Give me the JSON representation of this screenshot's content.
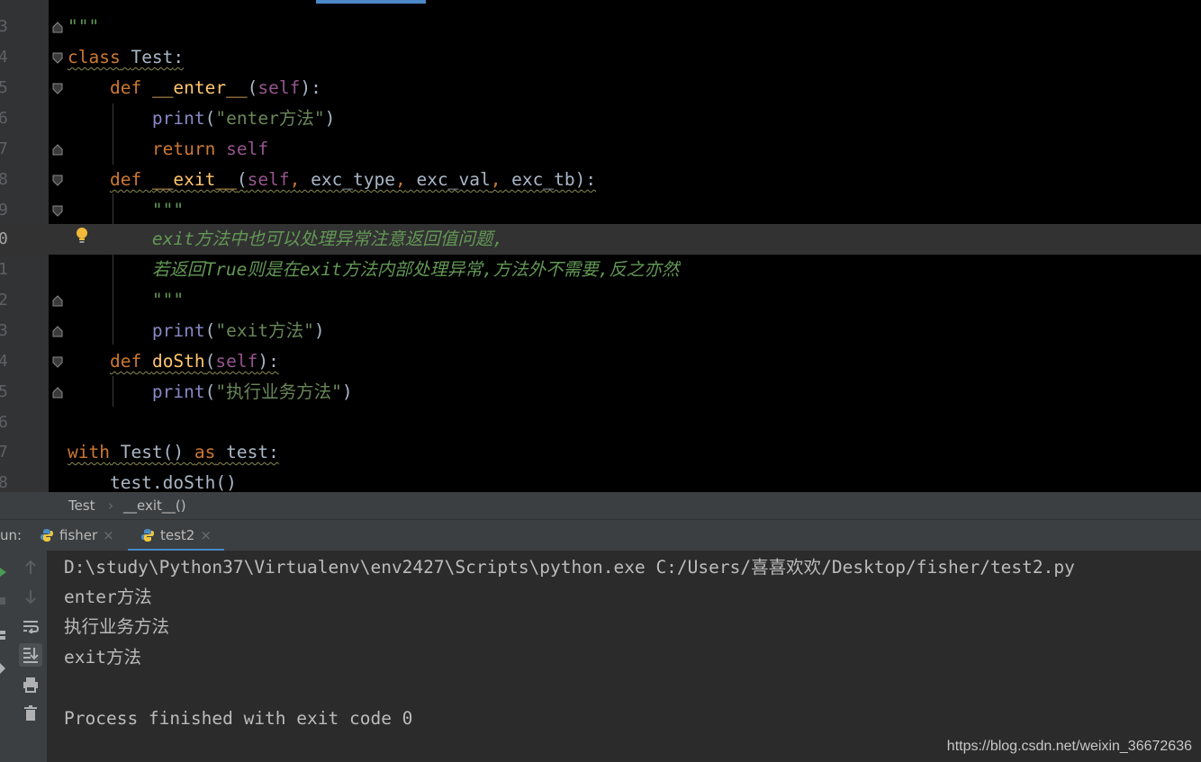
{
  "editor": {
    "lines": [
      {
        "num": "3",
        "code": "\"\"\""
      },
      {
        "num": "4",
        "code": "class Test:"
      },
      {
        "num": "5",
        "code": "    def __enter__(self):"
      },
      {
        "num": "6",
        "code": "        print(\"enter方法\")"
      },
      {
        "num": "7",
        "code": "        return self"
      },
      {
        "num": "8",
        "code": "    def __exit__(self, exc_type, exc_val, exc_tb):"
      },
      {
        "num": "9",
        "code": "        \"\"\""
      },
      {
        "num": "0",
        "code": "        exit方法中也可以处理异常注意返回值问题,"
      },
      {
        "num": "1",
        "code": "        若返回True则是在exit方法内部处理异常,方法外不需要,反之亦然"
      },
      {
        "num": "2",
        "code": "        \"\"\""
      },
      {
        "num": "3",
        "code": "        print(\"exit方法\")"
      },
      {
        "num": "4",
        "code": "    def doSth(self):"
      },
      {
        "num": "5",
        "code": "        print(\"执行业务方法\")"
      },
      {
        "num": "6",
        "code": ""
      },
      {
        "num": "7",
        "code": "with Test() as test:"
      },
      {
        "num": "8",
        "code": "    test.doSth()"
      }
    ]
  },
  "breadcrumb": {
    "class_name": "Test",
    "separator": "›",
    "method_name": "__exit__()"
  },
  "run": {
    "label": "un:",
    "tabs": [
      {
        "name": "fisher",
        "close": "×"
      },
      {
        "name": "test2",
        "close": "×"
      }
    ]
  },
  "console": {
    "lines": [
      "D:\\study\\Python37\\Virtualenv\\env2427\\Scripts\\python.exe C:/Users/喜喜欢欢/Desktop/fisher/test2.py",
      "enter方法",
      "执行业务方法",
      "exit方法",
      "",
      "Process finished with exit code 0"
    ]
  },
  "watermark": "https://blog.csdn.net/weixin_36672636",
  "colors": {
    "keyword": "#cc7832",
    "self": "#94558d",
    "function": "#ffc66d",
    "builtin": "#8888c6",
    "string": "#6a8759",
    "docstring": "#629755",
    "accent": "#4a88c7"
  }
}
